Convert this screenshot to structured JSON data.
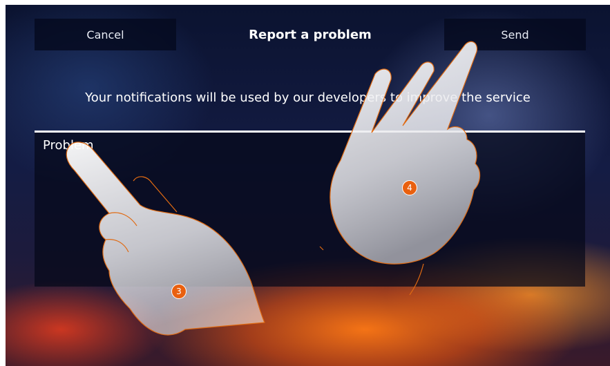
{
  "header": {
    "cancel_label": "Cancel",
    "title": "Report a problem",
    "send_label": "Send"
  },
  "subtitle": "Your notifications will be used by our developers to improve the service",
  "form": {
    "problem_label": "Problem"
  },
  "annotations": {
    "step_3": "3",
    "step_4": "4"
  },
  "colors": {
    "accent_orange": "#e9600f",
    "button_bg": "#050a1e",
    "text": "#ffffff"
  }
}
